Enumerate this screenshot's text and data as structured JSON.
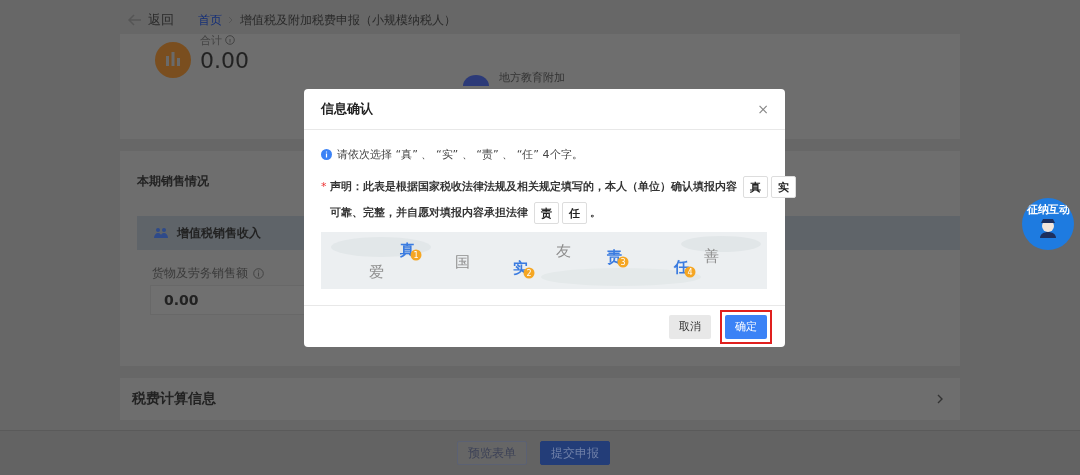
{
  "breadcrumb": {
    "back": "返回",
    "items": [
      {
        "text": "首页",
        "link": true
      },
      {
        "text": "增值税及附加税费申报（小规模纳税人）",
        "link": false
      }
    ]
  },
  "summary": {
    "total_label": "合计",
    "total_value": "0.00",
    "item_label": "地方教育附加"
  },
  "sales": {
    "title": "本期销售情况",
    "band_title": "增值税销售收入",
    "field_label": "货物及劳务销售额",
    "field_value": "0.00"
  },
  "calc": {
    "title": "税费计算信息"
  },
  "footer_buttons": [
    {
      "label": "预览表单",
      "kind": "secondary"
    },
    {
      "label": "提交申报",
      "kind": "primary"
    }
  ],
  "mascot": {
    "label": "征纳互动"
  },
  "dialog": {
    "title": "信息确认",
    "close": "×",
    "hint": "请依次选择 “真” 、 “实” 、 “责” 、 “任” 4个字。",
    "statement": {
      "required_mark": "*",
      "lines": [
        [
          {
            "kind": "text",
            "text": "声明：此表是根据国家税收法律法规及相关规定填写的，本人（单位）确认填报内容"
          },
          {
            "kind": "slot",
            "text": "真"
          },
          {
            "kind": "slot",
            "text": "实"
          }
        ],
        [
          {
            "kind": "text",
            "text": "可靠、完整，并自愿对填报内容承担法律"
          },
          {
            "kind": "slot",
            "text": "责"
          },
          {
            "kind": "slot",
            "text": "任"
          },
          {
            "kind": "text",
            "text": "。"
          }
        ]
      ]
    },
    "captcha": {
      "chars": [
        {
          "text": "爱",
          "selected": false
        },
        {
          "text": "真",
          "selected": true,
          "order": "1"
        },
        {
          "text": "国",
          "selected": false
        },
        {
          "text": "实",
          "selected": true,
          "order": "2"
        },
        {
          "text": "友",
          "selected": false
        },
        {
          "text": "责",
          "selected": true,
          "order": "3"
        },
        {
          "text": "任",
          "selected": true,
          "order": "4"
        },
        {
          "text": "善",
          "selected": false
        }
      ]
    },
    "buttons": [
      {
        "label": "取消",
        "kind": "default",
        "highlighted": false
      },
      {
        "label": "确定",
        "kind": "primary",
        "highlighted": true
      }
    ]
  }
}
